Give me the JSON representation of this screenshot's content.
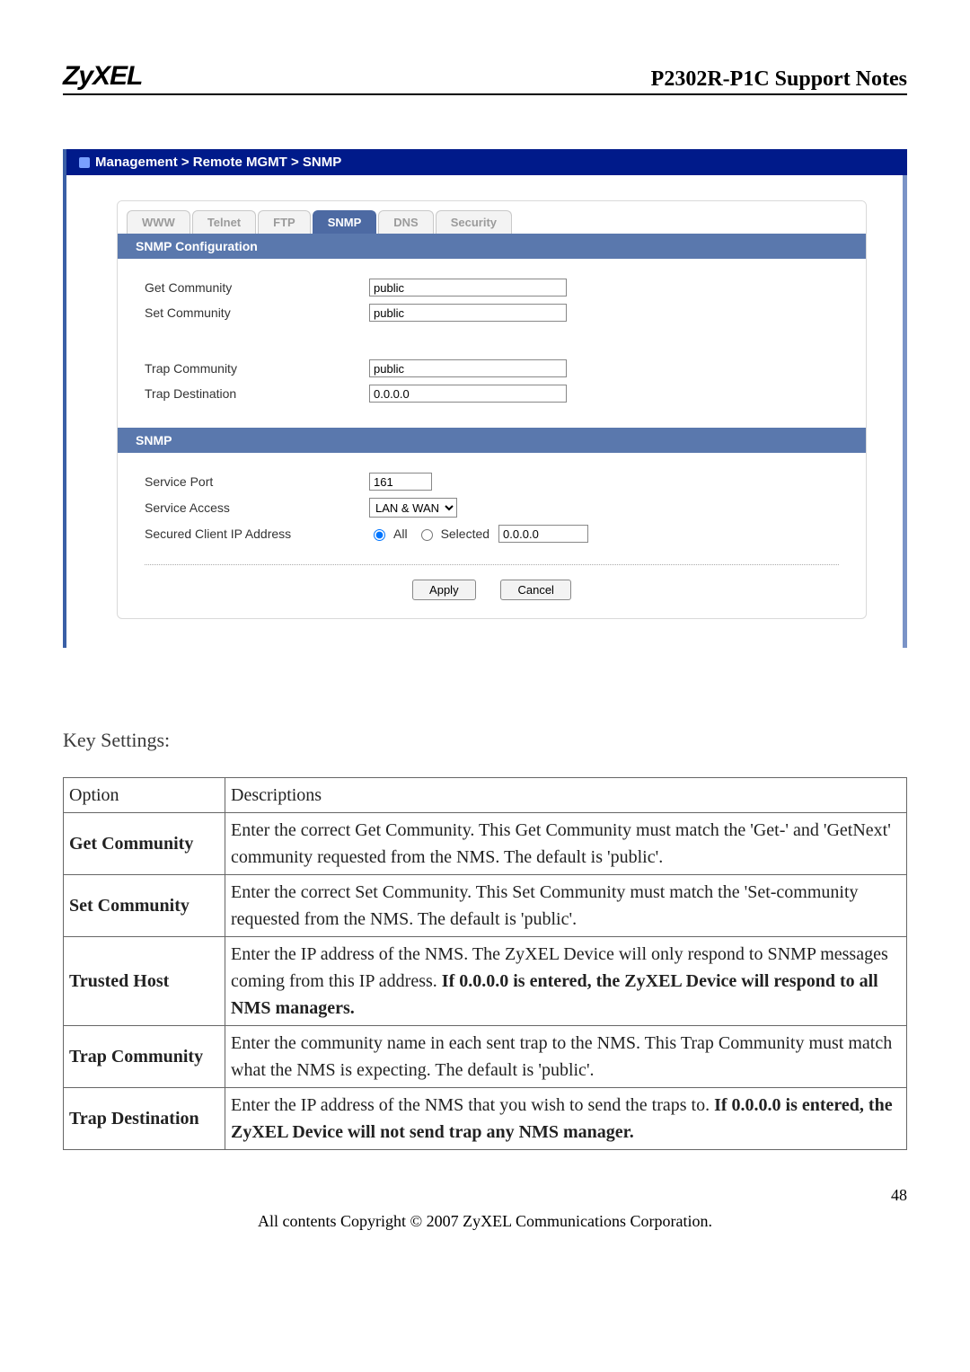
{
  "header": {
    "brand": "ZyXEL",
    "title": "P2302R-P1C Support Notes"
  },
  "screenshot": {
    "breadcrumb": "Management > Remote MGMT > SNMP",
    "tabs": [
      "WWW",
      "Telnet",
      "FTP",
      "SNMP",
      "DNS",
      "Security"
    ],
    "active_tab_index": 3,
    "sections": {
      "snmp_config_title": "SNMP Configuration",
      "get_community_label": "Get Community",
      "get_community_value": "public",
      "set_community_label": "Set Community",
      "set_community_value": "public",
      "trap_community_label": "Trap  Community",
      "trap_community_value": "public",
      "trap_destination_label": "Trap  Destination",
      "trap_destination_value": "0.0.0.0",
      "snmp_title": "SNMP",
      "service_port_label": "Service Port",
      "service_port_value": "161",
      "service_access_label": "Service Access",
      "service_access_value": "LAN & WAN",
      "secured_client_label": "Secured Client IP Address",
      "radio_all": "All",
      "radio_selected": "Selected",
      "secured_ip_value": "0.0.0.0",
      "apply": "Apply",
      "cancel": "Cancel"
    }
  },
  "key_settings_label": "Key Settings:",
  "table": {
    "headers": [
      "Option",
      "Descriptions"
    ],
    "rows": [
      {
        "option": "Get Community",
        "desc_plain": "Enter the correct Get Community. This Get Community must match the 'Get-' and 'GetNext' community requested from the NMS. The default is 'public'."
      },
      {
        "option": "Set Community",
        "desc_plain": "Enter the correct Set Community. This Set Community must match the 'Set-community requested from the NMS. The default is 'public'."
      },
      {
        "option": "Trusted Host",
        "desc_pre": "Enter the IP address of the NMS. The ZyXEL Device will only respond to SNMP messages coming from this IP address. ",
        "desc_bold": "If 0.0.0.0 is entered, the ZyXEL Device will respond to all NMS managers."
      },
      {
        "option": "Trap Community",
        "desc_plain": "Enter the community name in each sent trap to the NMS. This Trap Community must match what the NMS is expecting. The default is 'public'."
      },
      {
        "option": "Trap Destination",
        "desc_pre": "Enter the IP address of the NMS that you wish to send the traps to. ",
        "desc_bold": "If 0.0.0.0 is entered, the ZyXEL Device will not send trap any NMS manager."
      }
    ]
  },
  "page_number": "48",
  "copyright": "All contents Copyright © 2007 ZyXEL Communications Corporation."
}
